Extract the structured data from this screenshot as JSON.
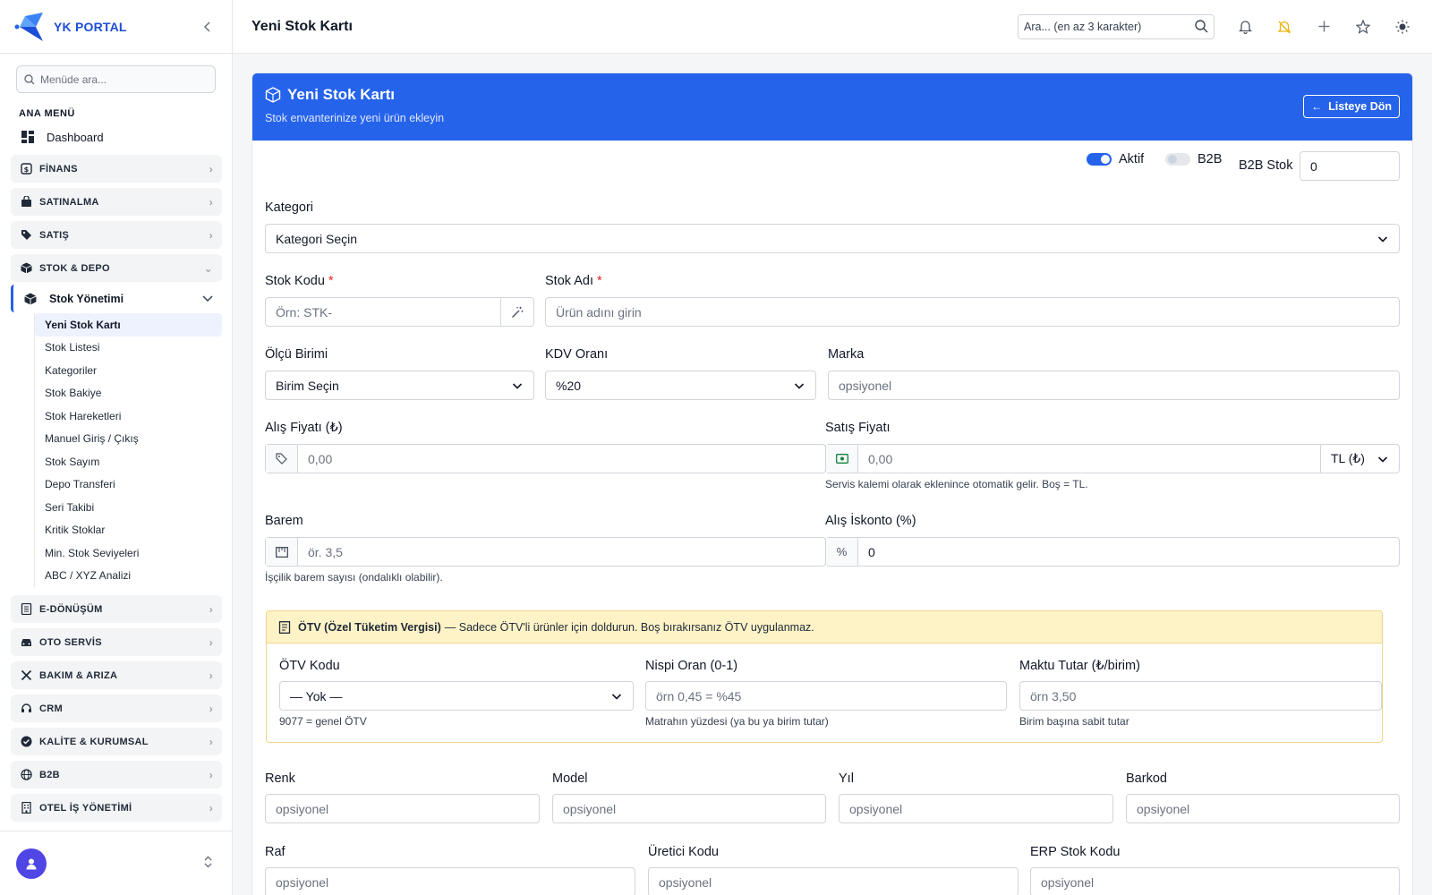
{
  "brand": {
    "name": "YK PORTAL"
  },
  "sidebar": {
    "search_placeholder": "Menüde ara...",
    "section_title": "ANA MENÜ",
    "dashboard_label": "Dashboard",
    "groups": [
      {
        "label": "FİNANS",
        "icon": "finance-icon"
      },
      {
        "label": "SATINALMA",
        "icon": "shopping-bag-icon"
      },
      {
        "label": "SATIŞ",
        "icon": "tag-icon"
      },
      {
        "label": "STOK & DEPO",
        "icon": "box-icon"
      },
      {
        "label": "E-DÖNÜŞÜM",
        "icon": "document-icon"
      },
      {
        "label": "OTO SERVİS",
        "icon": "car-icon"
      },
      {
        "label": "BAKIM & ARIZA",
        "icon": "tools-icon"
      },
      {
        "label": "CRM",
        "icon": "headset-icon"
      },
      {
        "label": "KALİTE & KURUMSAL",
        "icon": "badge-check-icon"
      },
      {
        "label": "B2B",
        "icon": "globe-icon"
      },
      {
        "label": "OTEL İŞ YÖNETİMİ",
        "icon": "building-icon"
      }
    ],
    "stock_management": {
      "label": "Stok Yönetimi",
      "items": [
        "Yeni Stok Kartı",
        "Stok Listesi",
        "Kategoriler",
        "Stok Bakiye",
        "Stok Hareketleri",
        "Manuel Giriş / Çıkış",
        "Stok Sayım",
        "Depo Transferi",
        "Seri Takibi",
        "Kritik Stoklar",
        "Min. Stok Seviyeleri",
        "ABC / XYZ Analizi"
      ],
      "active_index": 0
    }
  },
  "topbar": {
    "title": "Yeni Stok Kartı",
    "search_placeholder": "Ara... (en az 3 karakter)"
  },
  "card": {
    "title": "Yeni Stok Kartı",
    "subtitle": "Stok envanterinize yeni ürün ekleyin",
    "back_label": "Listeye Dön"
  },
  "form": {
    "active_label": "Aktif",
    "active_on": true,
    "b2b_label": "B2B",
    "b2b_on": false,
    "b2b_stock_label": "B2B Stok",
    "b2b_stock_value": "0",
    "category_label": "Kategori",
    "category_value": "Kategori Seçin",
    "stock_code_label": "Stok Kodu",
    "stock_code_placeholder": "Örn: STK-",
    "stock_name_label": "Stok Adı",
    "stock_name_placeholder": "Ürün adını girin",
    "required_mark": "*",
    "unit_label": "Ölçü Birimi",
    "unit_value": "Birim Seçin",
    "vat_label": "KDV Oranı",
    "vat_value": "%20",
    "brand_label": "Marka",
    "brand_placeholder": "opsiyonel",
    "buy_price_label": "Alış Fiyatı (₺)",
    "buy_price_placeholder": "0,00",
    "sell_price_label": "Satış Fiyatı",
    "sell_price_placeholder": "0,00",
    "currency_value": "TL (₺)",
    "sell_help": "Servis kalemi olarak eklenince otomatik gelir. Boş = TL.",
    "barem_label": "Barem",
    "barem_placeholder": "ör. 3,5",
    "barem_help": "İşçilik barem sayısı (ondalıklı olabilir).",
    "discount_label": "Alış İskonto (%)",
    "discount_prefix": "%",
    "discount_value": "0",
    "otv": {
      "title": "ÖTV (Özel Tüketim Vergisi)",
      "note": "— Sadece ÖTV'li ürünler için doldurun. Boş bırakırsanız ÖTV uygulanmaz.",
      "code_label": "ÖTV Kodu",
      "code_value": "— Yok —",
      "code_help": "9077 = genel ÖTV",
      "ratio_label": "Nispi Oran (0-1)",
      "ratio_placeholder": "örn 0,45 = %45",
      "ratio_help": "Matrahın yüzdesi (ya bu ya birim tutar)",
      "fixed_label": "Maktu Tutar (₺/birim)",
      "fixed_placeholder": "örn 3,50",
      "fixed_help": "Birim başına sabit tutar"
    },
    "color_label": "Renk",
    "model_label": "Model",
    "year_label": "Yıl",
    "barcode_label": "Barkod",
    "shelf_label": "Raf",
    "manufacturer_code_label": "Üretici Kodu",
    "erp_code_label": "ERP Stok Kodu",
    "optional_placeholder": "opsiyonel"
  },
  "colors": {
    "accent": "#2563eb",
    "otv_bg": "#fef3c7",
    "required": "#dc2626"
  }
}
